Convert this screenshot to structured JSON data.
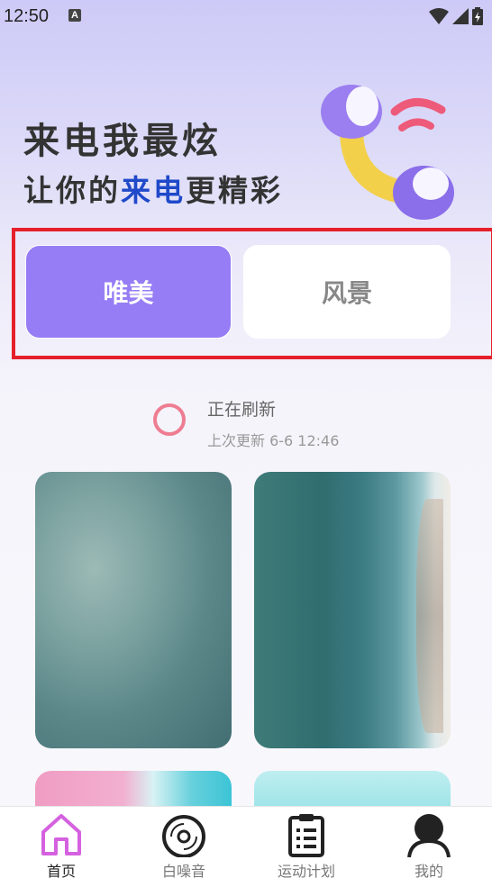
{
  "status_bar": {
    "time": "12:50",
    "notif_icon_letter": "A"
  },
  "hero": {
    "line1": "来电我最炫",
    "line2_prefix": "让你的",
    "line2_highlight": "来电",
    "line2_suffix": "更精彩",
    "highlight_color": "#1f49c9"
  },
  "tabs": [
    {
      "label": "唯美",
      "active": true
    },
    {
      "label": "风景",
      "active": false
    }
  ],
  "refresh": {
    "title": "正在刷新",
    "subtitle": "上次更新 6-6 12:46"
  },
  "nav": [
    {
      "label": "首页",
      "icon": "home-icon",
      "active": true
    },
    {
      "label": "白噪音",
      "icon": "vinyl-disc-icon",
      "active": false
    },
    {
      "label": "运动计划",
      "icon": "clipboard-list-icon",
      "active": false
    },
    {
      "label": "我的",
      "icon": "user-icon",
      "active": false
    }
  ],
  "colors": {
    "accent": "#967df5",
    "highlight_frame": "#e5202b",
    "refresh_ring": "#ee7d92",
    "home_icon": "#d561e0"
  }
}
